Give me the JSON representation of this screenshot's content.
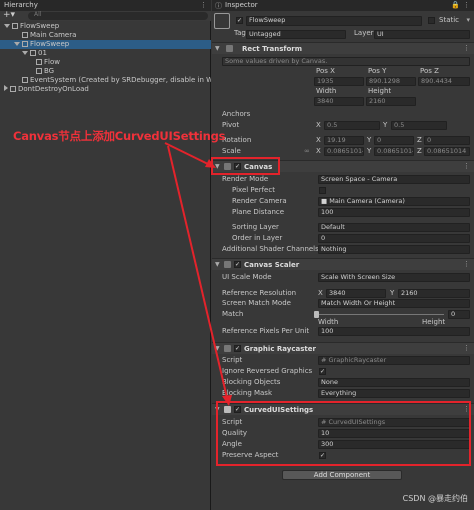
{
  "hierarchy": {
    "tab": "Hierarchy",
    "search_placeholder": "All",
    "items": [
      {
        "label": "FlowSweep"
      },
      {
        "label": "Main Camera"
      },
      {
        "label": "FlowSweep"
      },
      {
        "label": "01"
      },
      {
        "label": "Flow"
      },
      {
        "label": "BG"
      },
      {
        "label": "EventSystem (Created by SRDebugger, disable in Windo"
      },
      {
        "label": "DontDestroyOnLoad"
      }
    ]
  },
  "inspector": {
    "tab": "Inspector",
    "object_name": "FlowSweep",
    "static_label": "Static",
    "tag_label": "Tag",
    "tag_value": "Untagged",
    "layer_label": "Layer",
    "layer_value": "UI",
    "rect_transform": {
      "title": "Rect Transform",
      "note": "Some values driven by Canvas.",
      "pos_x_label": "Pos X",
      "pos_y_label": "Pos Y",
      "pos_z_label": "Pos Z",
      "pos_x": "1935",
      "pos_y": "890.1298",
      "pos_z": "890.4434",
      "width_label": "Width",
      "height_label": "Height",
      "width": "3840",
      "height": "2160",
      "anchors": "Anchors",
      "pivot": "Pivot",
      "pivot_x": "0.5",
      "pivot_y": "0.5",
      "rotation": "Rotation",
      "rot_x": "19.19",
      "rot_y": "0",
      "rot_z": "0",
      "scale": "Scale",
      "scale_x": "0.08651014",
      "scale_y": "0.08651014",
      "scale_z": "0.08651014",
      "x": "X",
      "y": "Y",
      "z": "Z"
    },
    "canvas": {
      "title": "Canvas",
      "render_mode_label": "Render Mode",
      "render_mode": "Screen Space - Camera",
      "pixel_perfect": "Pixel Perfect",
      "render_camera_label": "Render Camera",
      "render_camera": "Main Camera (Camera)",
      "plane_distance_label": "Plane Distance",
      "plane_distance": "100",
      "sorting_layer_label": "Sorting Layer",
      "sorting_layer": "Default",
      "order_label": "Order in Layer",
      "order": "0",
      "shader_channels_label": "Additional Shader Channels",
      "shader_channels": "Nothing"
    },
    "canvas_scaler": {
      "title": "Canvas Scaler",
      "scale_mode_label": "UI Scale Mode",
      "scale_mode": "Scale With Screen Size",
      "ref_res_label": "Reference Resolution",
      "ref_x": "3840",
      "ref_y": "2160",
      "match_mode_label": "Screen Match Mode",
      "match_mode": "Match Width Or Height",
      "match_label": "Match",
      "match_width": "Width",
      "match_height": "Height",
      "ppu_label": "Reference Pixels Per Unit",
      "ppu": "100"
    },
    "graphic_raycaster": {
      "title": "Graphic Raycaster",
      "script_label": "Script",
      "script": "GraphicRaycaster",
      "ignore_label": "Ignore Reversed Graphics",
      "blocking_objects_label": "Blocking Objects",
      "blocking_objects": "None",
      "blocking_mask_label": "Blocking Mask",
      "blocking_mask": "Everything"
    },
    "curved_ui": {
      "title": "CurvedUISettings",
      "script_label": "Script",
      "script": "CurvedUISettings",
      "quality_label": "Quality",
      "quality": "10",
      "angle_label": "Angle",
      "angle": "300",
      "preserve_label": "Preserve Aspect"
    },
    "add_component": "Add Component"
  },
  "annotation": "Canvas节点上添加CurvedUISettings",
  "watermark": "CSDN @暴走约伯",
  "colors": {
    "annotation": "#e3232b",
    "selection": "#2c5d87"
  }
}
